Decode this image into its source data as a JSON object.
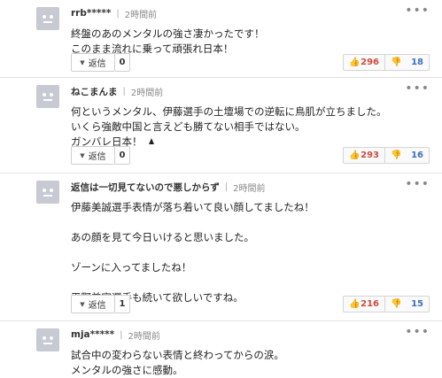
{
  "comments": [
    {
      "username": "rrb*****",
      "separator": "|",
      "time": "2時間前",
      "lines": [
        "終盤のあのメンタルの強さ凄かったです！",
        "このまま流れに乗って頑張れ日本！"
      ],
      "reply_label": "返信",
      "reply_count": "0",
      "good": "296",
      "bad": "18"
    },
    {
      "username": "ねこまんま",
      "separator": "|",
      "time": "2時間前",
      "lines": [
        "何というメンタル、伊藤選手の土壇場での逆転に鳥肌が立ちました。",
        "いくら強敵中国と言えども勝てない相手ではない。",
        "ガンバレ日本！"
      ],
      "reply_label": "返信",
      "reply_count": "0",
      "good": "293",
      "bad": "16"
    },
    {
      "username": "返信は一切見てないので悪しからず",
      "separator": "|",
      "time": "2時間前",
      "lines": [
        "伊藤美誠選手表情が落ち着いて良い顔してましたね！",
        "",
        "あの顔を見て今日いけると思いました。",
        "",
        "ゾーンに入ってましたね！",
        "",
        "平野美宇選手も続いて欲しいですね。"
      ],
      "reply_label": "返信",
      "reply_count": "1",
      "good": "216",
      "bad": "15"
    },
    {
      "username": "mja*****",
      "separator": "|",
      "time": "2時間前",
      "lines": [
        "試合中の変わらない表情と終わってからの涙。",
        "メンタルの強さに感動。"
      ]
    }
  ],
  "icons": {
    "more": "more-horizontal-icon",
    "reply": "triangle-down-icon",
    "good": "thumbs-up-icon",
    "bad": "thumbs-down-icon"
  }
}
